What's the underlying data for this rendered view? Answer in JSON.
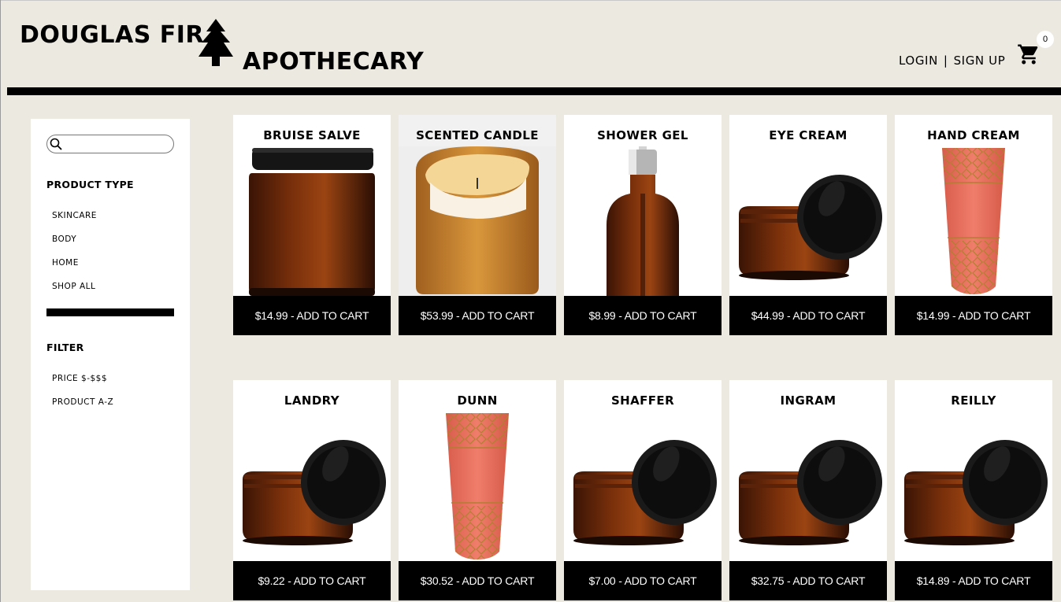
{
  "header": {
    "brand_line1": "DOUGLAS FIR",
    "brand_line2": "APOTHECARY",
    "login": "LOGIN",
    "separator": "|",
    "signup": "SIGN UP",
    "cart_count": "0"
  },
  "sidebar": {
    "search": {
      "value": "",
      "placeholder": ""
    },
    "product_type_heading": "PRODUCT TYPE",
    "product_types": [
      "SKINCARE",
      "BODY",
      "HOME",
      "SHOP ALL"
    ],
    "filter_heading": "FILTER",
    "filters": [
      "PRICE $-$$$",
      "PRODUCT A-Z"
    ]
  },
  "products": [
    {
      "name": "BRUISE SALVE",
      "price": "$14.99",
      "button": "$14.99 - ADD TO CART",
      "image": "amber-jar-closed"
    },
    {
      "name": "SCENTED CANDLE",
      "price": "$53.99",
      "button": "$53.99 - ADD TO CART",
      "image": "amber-candle"
    },
    {
      "name": "SHOWER GEL",
      "price": "$8.99",
      "button": "$8.99 - ADD TO CART",
      "image": "amber-pump-bottle"
    },
    {
      "name": "EYE CREAM",
      "price": "$44.99",
      "button": "$44.99 - ADD TO CART",
      "image": "amber-jar-open"
    },
    {
      "name": "HAND CREAM",
      "price": "$14.99",
      "button": "$14.99 - ADD TO CART",
      "image": "coral-tube"
    },
    {
      "name": "LANDRY",
      "price": "$9.22",
      "button": "$9.22 - ADD TO CART",
      "image": "amber-jar-open"
    },
    {
      "name": "DUNN",
      "price": "$30.52",
      "button": "$30.52 - ADD TO CART",
      "image": "coral-tube"
    },
    {
      "name": "SHAFFER",
      "price": "$7.00",
      "button": "$7.00 - ADD TO CART",
      "image": "amber-jar-open"
    },
    {
      "name": "INGRAM",
      "price": "$32.75",
      "button": "$32.75 - ADD TO CART",
      "image": "amber-jar-open"
    },
    {
      "name": "REILLY",
      "price": "$14.89",
      "button": "$14.89 - ADD TO CART",
      "image": "amber-jar-open"
    }
  ],
  "colors": {
    "background": "#ece9e1",
    "card": "#ffffff",
    "button": "#000000",
    "amber": "#8a3a0c",
    "coral": "#ec7462"
  }
}
